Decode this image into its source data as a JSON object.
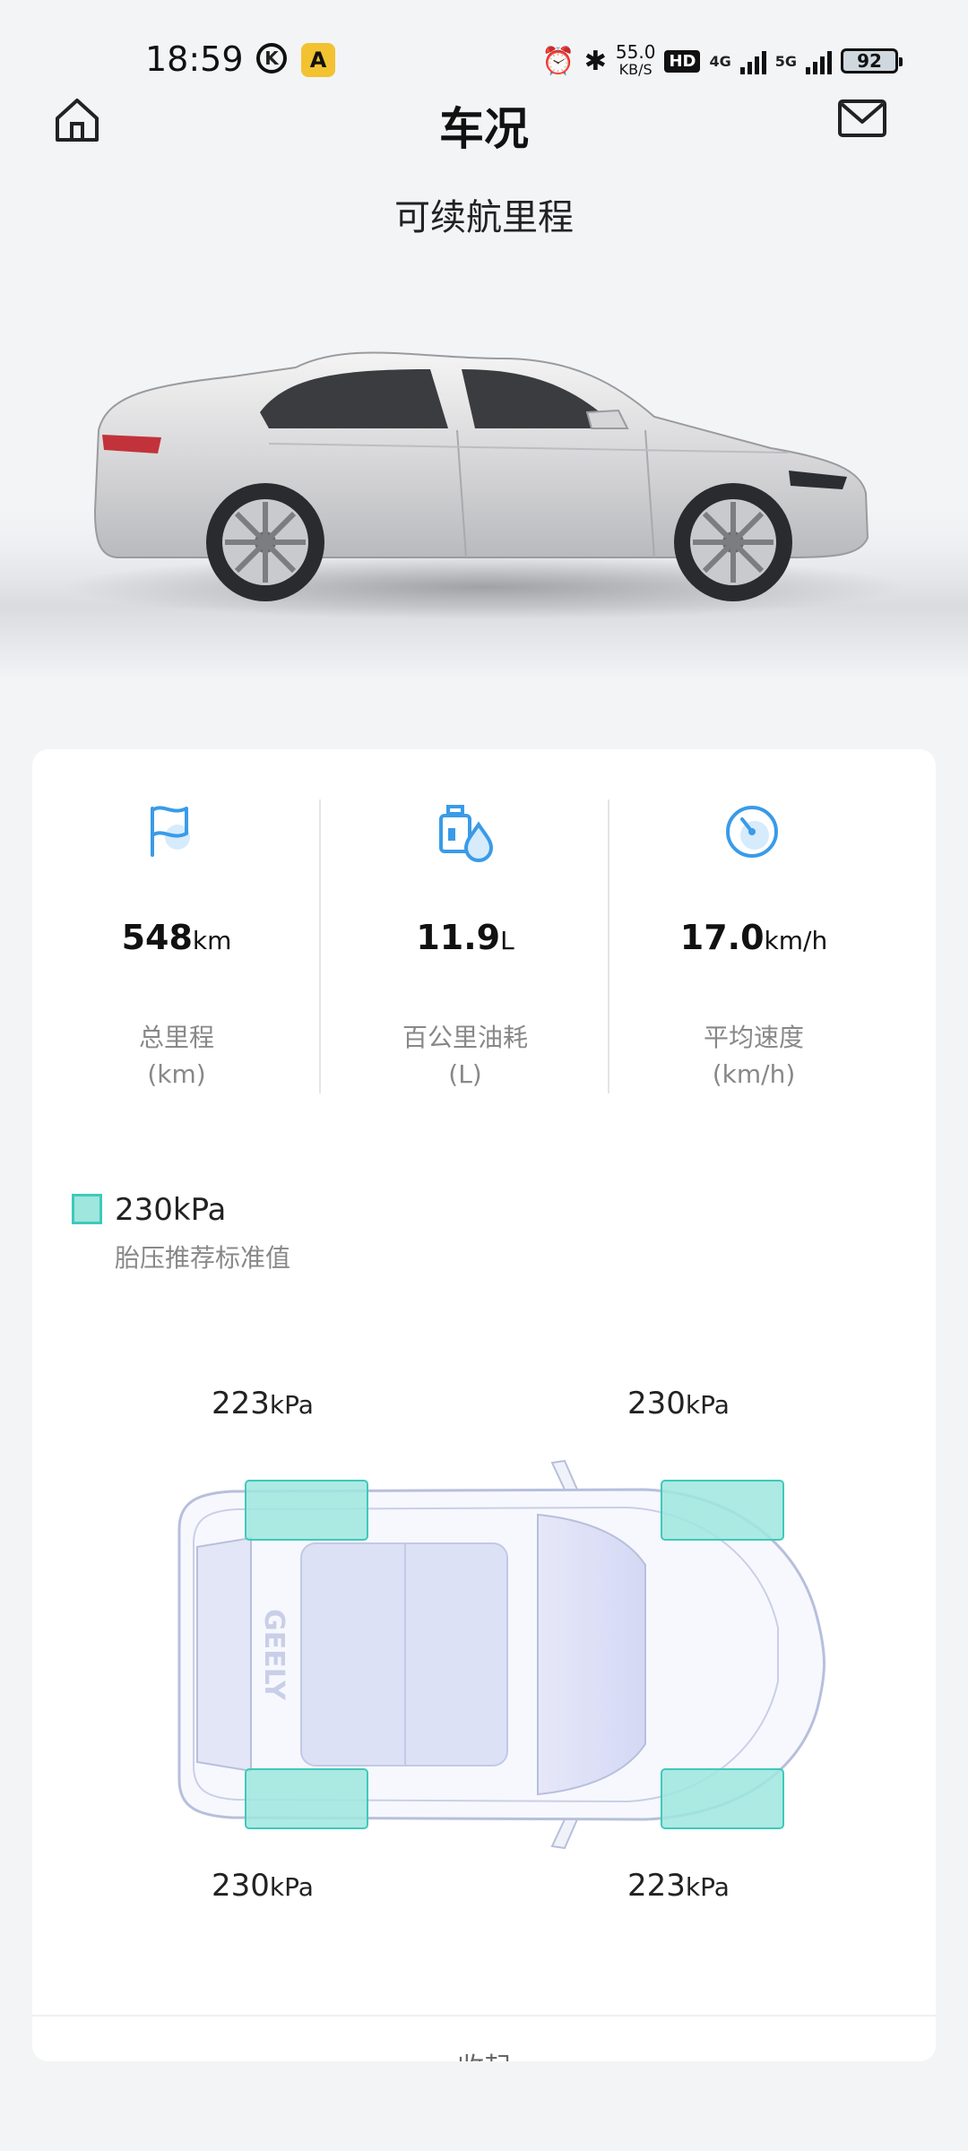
{
  "status": {
    "time": "18:59",
    "app_k": "K",
    "app_a": "A",
    "net_speed_value": "55.0",
    "net_speed_unit": "KB/S",
    "hd": "HD",
    "net_4g": "4G",
    "net_5g": "5G",
    "battery": "92"
  },
  "nav": {
    "title": "车况"
  },
  "range_label": "可续航里程",
  "stats": [
    {
      "value": "548",
      "unit": "km",
      "label": "总里程",
      "unit_label": "(km)",
      "icon": "flag-icon"
    },
    {
      "value": "11.9",
      "unit": "L",
      "label": "百公里油耗",
      "unit_label": "(L)",
      "icon": "fuel-icon"
    },
    {
      "value": "17.0",
      "unit": "km/h",
      "label": "平均速度",
      "unit_label": "(km/h)",
      "icon": "speedometer-icon"
    }
  ],
  "tire_pressure": {
    "legend_value": "230kPa",
    "legend_label": "胎压推荐标准值",
    "front_left": {
      "value": "223",
      "unit": "kPa"
    },
    "front_right": {
      "value": "230",
      "unit": "kPa"
    },
    "rear_left": {
      "value": "230",
      "unit": "kPa"
    },
    "rear_right": {
      "value": "223",
      "unit": "kPa"
    },
    "brand_text": "GEELY"
  },
  "collapse_label": "收起",
  "colors": {
    "accent_blue": "#3a9be8",
    "tire_fill": "#9ee6de",
    "tire_stroke": "#3fc9bb"
  }
}
